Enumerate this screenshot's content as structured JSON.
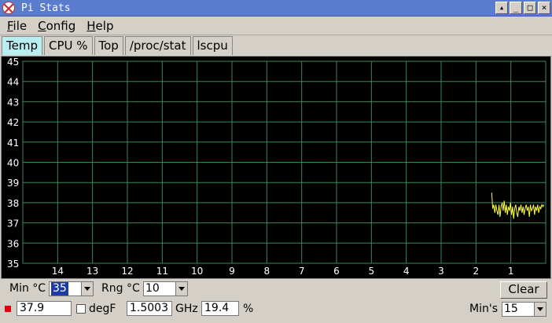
{
  "window": {
    "title": "Pi Stats"
  },
  "menu": [
    {
      "mnemonic": "F",
      "rest": "ile"
    },
    {
      "mnemonic": "C",
      "rest": "onfig"
    },
    {
      "mnemonic": "H",
      "rest": "elp"
    }
  ],
  "tabs": [
    {
      "label": "Temp",
      "active": true
    },
    {
      "label": "CPU %",
      "active": false
    },
    {
      "label": "Top",
      "active": false
    },
    {
      "label": "/proc/stat",
      "active": false
    },
    {
      "label": "lscpu",
      "active": false
    }
  ],
  "chart_data": {
    "type": "line",
    "ylim": [
      35,
      45
    ],
    "yticks": [
      "45",
      "44",
      "43",
      "42",
      "41",
      "40",
      "39",
      "38",
      "37",
      "36",
      "35"
    ],
    "xticks": [
      "14",
      "13",
      "12",
      "11",
      "10",
      "9",
      "8",
      "7",
      "6",
      "5",
      "4",
      "3",
      "2",
      "1"
    ],
    "xlim": [
      15,
      0
    ],
    "grid": true,
    "colors": {
      "background": "#000000",
      "grid": "#3a8a5a",
      "line": "#ffff40"
    },
    "series": [
      {
        "x": [
          1.55,
          1.52,
          1.49,
          1.46,
          1.43,
          1.4,
          1.37,
          1.34,
          1.31,
          1.28,
          1.25,
          1.22,
          1.19,
          1.16,
          1.13,
          1.1,
          1.07,
          1.04,
          1.01,
          0.98,
          0.95,
          0.92,
          0.89,
          0.86,
          0.83,
          0.8,
          0.77,
          0.74,
          0.71,
          0.68,
          0.65,
          0.62,
          0.59,
          0.56,
          0.53,
          0.5,
          0.47,
          0.44,
          0.41,
          0.38,
          0.35,
          0.32,
          0.29,
          0.26,
          0.23,
          0.2,
          0.17,
          0.14,
          0.11,
          0.08,
          0.05
        ],
        "values": [
          38.5,
          37.7,
          37.9,
          37.5,
          37.9,
          37.6,
          37.4,
          37.9,
          37.3,
          37.8,
          38.0,
          37.6,
          38.1,
          37.5,
          37.9,
          37.4,
          37.8,
          37.6,
          38.0,
          37.4,
          37.8,
          37.2,
          37.7,
          37.9,
          37.5,
          37.3,
          37.8,
          37.6,
          37.9,
          37.5,
          37.8,
          37.4,
          37.7,
          37.9,
          37.6,
          37.8,
          37.3,
          37.9,
          37.6,
          37.7,
          37.9,
          37.4,
          37.8,
          37.6,
          37.9,
          37.5,
          37.8,
          37.7,
          37.9,
          37.8,
          37.9
        ]
      }
    ]
  },
  "controls": {
    "min_label": "Min °C",
    "min_value": "35",
    "rng_label": "Rng °C",
    "rng_value": "10",
    "clear_label": "Clear",
    "temp_value": "37.9",
    "degf_label": "degF",
    "ghz_value": "1.5003",
    "ghz_label": "GHz",
    "cpu_value": "19.4",
    "pct_label": "%",
    "mins_label": "Min's",
    "mins_value": "15",
    "led_color": "#e00010"
  }
}
